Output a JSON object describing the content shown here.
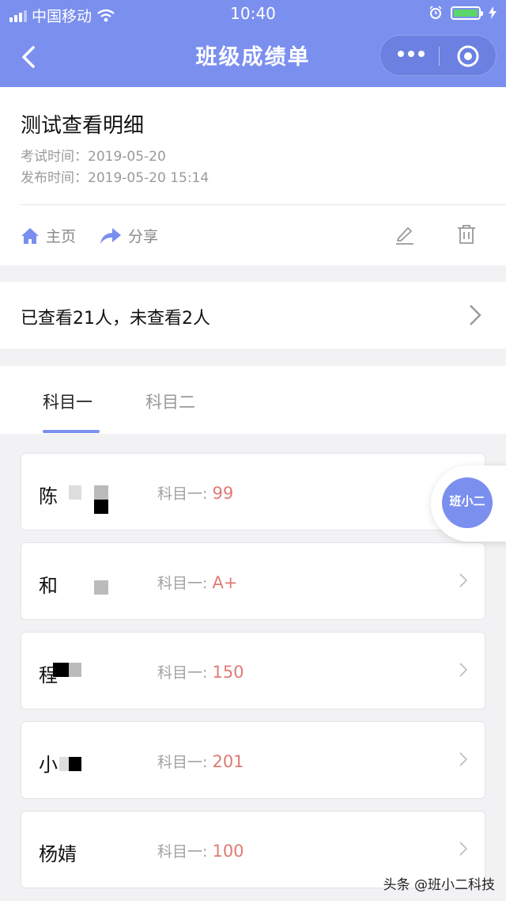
{
  "status_bar": {
    "carrier": "中国移动",
    "time": "10:40",
    "icons": [
      "signal-icon",
      "wifi-icon",
      "alarm-icon",
      "battery-icon",
      "charging-icon"
    ]
  },
  "nav": {
    "title": "班级成绩单",
    "back_icon": "chevron-left-icon",
    "more_icon": "more-dots-icon",
    "close_icon": "target-circle-icon"
  },
  "test": {
    "title": "测试查看明细",
    "exam_time": "考试时间：2019-05-20",
    "publish_time": "发布时间：2019-05-20 15:14"
  },
  "actions": {
    "home_label": "主页",
    "share_label": "分享",
    "edit_icon": "edit-icon",
    "delete_icon": "trash-icon"
  },
  "viewed_summary": "已查看21人，未查看2人",
  "tabs": [
    {
      "label": "科目一",
      "active": true
    },
    {
      "label": "科目二",
      "active": false
    }
  ],
  "students": [
    {
      "name": "陈",
      "subject": "科目一: ",
      "score": "99"
    },
    {
      "name": "和",
      "subject": "科目一: ",
      "score": "A+"
    },
    {
      "name": "程",
      "subject": "科目一: ",
      "score": "150"
    },
    {
      "name": "小",
      "subject": "科目一: ",
      "score": "201"
    },
    {
      "name": "杨婧",
      "subject": "科目一: ",
      "score": "100"
    }
  ],
  "floating_logo_text": "班小二",
  "watermark": "头条 @班小二科技",
  "colors": {
    "accent": "#7b8fef",
    "score": "#e07a74",
    "muted": "#9a9a9a",
    "background": "#f2f2f4"
  }
}
